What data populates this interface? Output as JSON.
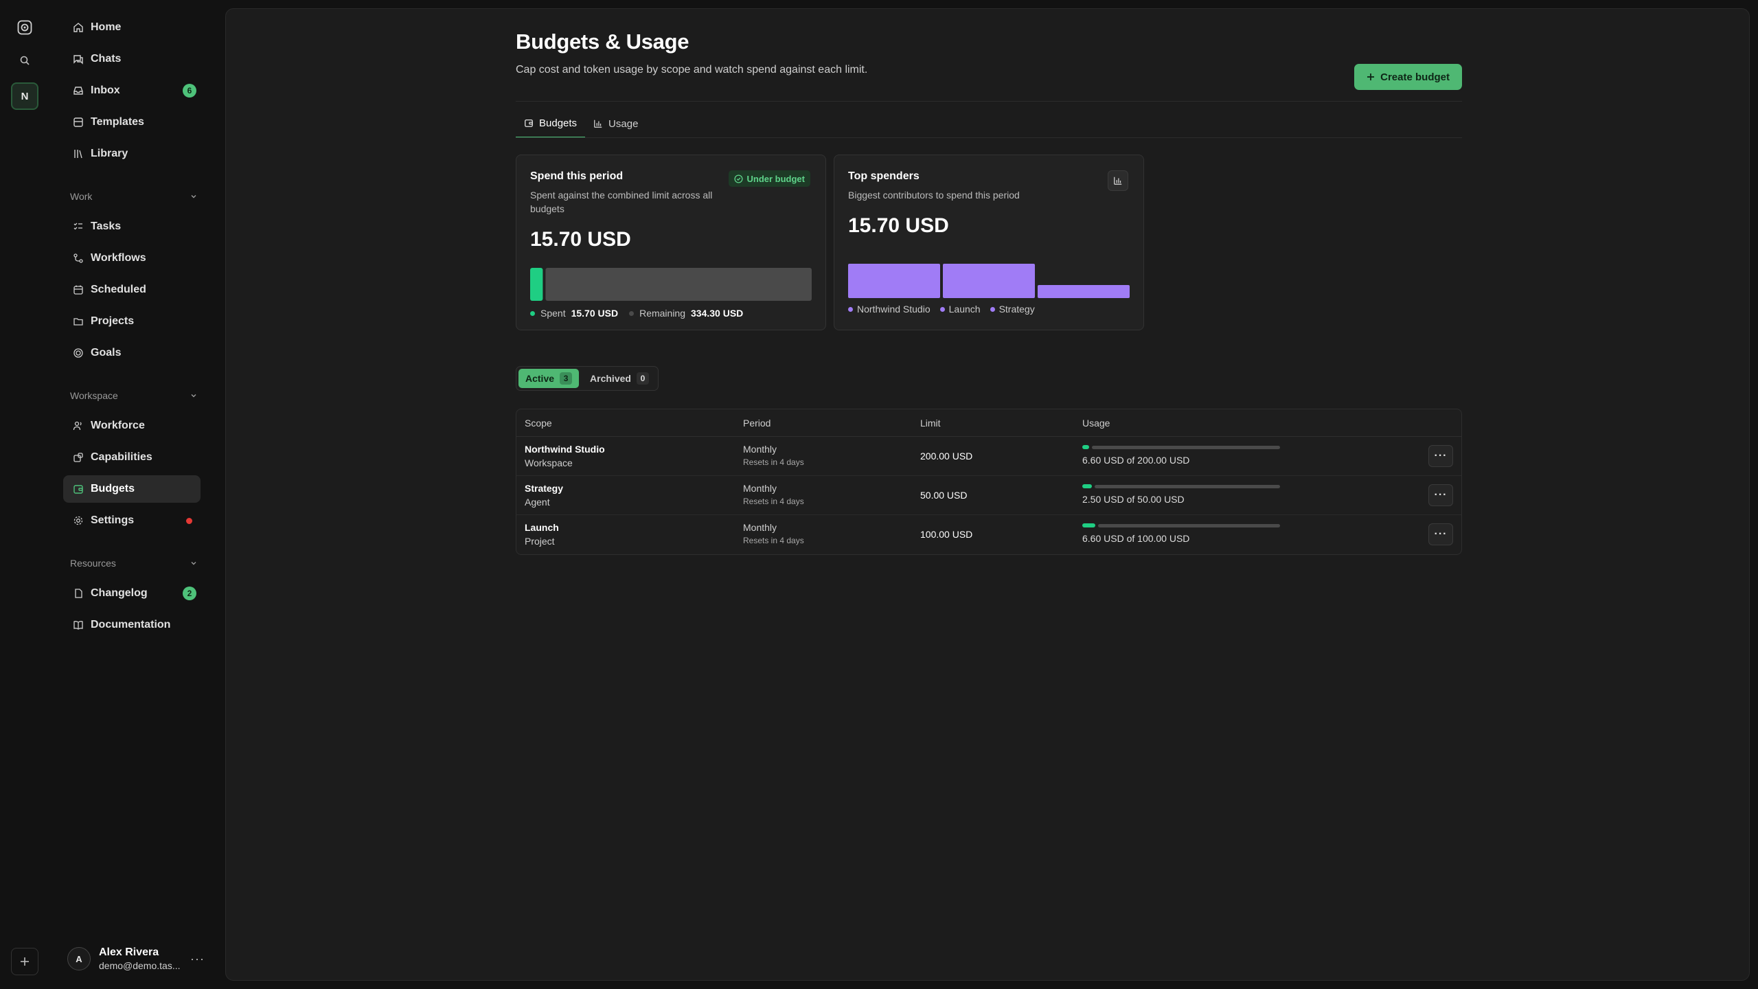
{
  "rail": {
    "workspace_initial": "N"
  },
  "sidebar": {
    "top": [
      {
        "label": "Home"
      },
      {
        "label": "Chats"
      },
      {
        "label": "Inbox",
        "badge": "6"
      },
      {
        "label": "Templates"
      },
      {
        "label": "Library"
      }
    ],
    "sections": {
      "work": "Work",
      "workspace": "Workspace",
      "resources": "Resources"
    },
    "work": [
      {
        "label": "Tasks"
      },
      {
        "label": "Workflows"
      },
      {
        "label": "Scheduled"
      },
      {
        "label": "Projects"
      },
      {
        "label": "Goals"
      }
    ],
    "workspace": [
      {
        "label": "Workforce"
      },
      {
        "label": "Capabilities"
      },
      {
        "label": "Budgets"
      },
      {
        "label": "Settings"
      }
    ],
    "resources": [
      {
        "label": "Changelog",
        "badge": "2"
      },
      {
        "label": "Documentation"
      }
    ],
    "user": {
      "initial": "A",
      "name": "Alex Rivera",
      "email": "demo@demo.tas..."
    }
  },
  "page": {
    "title": "Budgets & Usage",
    "subtitle": "Cap cost and token usage by scope and watch spend against each limit.",
    "create_label": "Create budget",
    "tabs": [
      {
        "label": "Budgets"
      },
      {
        "label": "Usage"
      }
    ]
  },
  "spend_card": {
    "title": "Spend this period",
    "subtitle": "Spent against the combined limit across all budgets",
    "status": "Under budget",
    "amount": "15.70 USD",
    "spent_label": "Spent",
    "spent_value": "15.70 USD",
    "remaining_label": "Remaining",
    "remaining_value": "334.30 USD",
    "spent_fraction": 0.0449,
    "colors": {
      "spent": "#1fce83",
      "remaining": "#4a4a4a"
    }
  },
  "top_spenders": {
    "title": "Top spenders",
    "subtitle": "Biggest contributors to spend this period",
    "amount": "15.70 USD",
    "color": "#a07cf6",
    "items": [
      {
        "name": "Northwind Studio",
        "value": 6.6
      },
      {
        "name": "Launch",
        "value": 6.6
      },
      {
        "name": "Strategy",
        "value": 2.5
      }
    ]
  },
  "filter": {
    "active_label": "Active",
    "active_count": "3",
    "archived_label": "Archived",
    "archived_count": "0"
  },
  "table": {
    "headers": {
      "scope": "Scope",
      "period": "Period",
      "limit": "Limit",
      "usage": "Usage"
    },
    "rows": [
      {
        "scope": "Northwind Studio",
        "type": "Workspace",
        "period": "Monthly",
        "reset": "Resets in 4 days",
        "limit": "200.00 USD",
        "usage": "6.60 USD of 200.00 USD",
        "fraction": 0.033
      },
      {
        "scope": "Strategy",
        "type": "Agent",
        "period": "Monthly",
        "reset": "Resets in 4 days",
        "limit": "50.00 USD",
        "usage": "2.50 USD of 50.00 USD",
        "fraction": 0.05
      },
      {
        "scope": "Launch",
        "type": "Project",
        "period": "Monthly",
        "reset": "Resets in 4 days",
        "limit": "100.00 USD",
        "usage": "6.60 USD of 100.00 USD",
        "fraction": 0.066
      }
    ]
  }
}
